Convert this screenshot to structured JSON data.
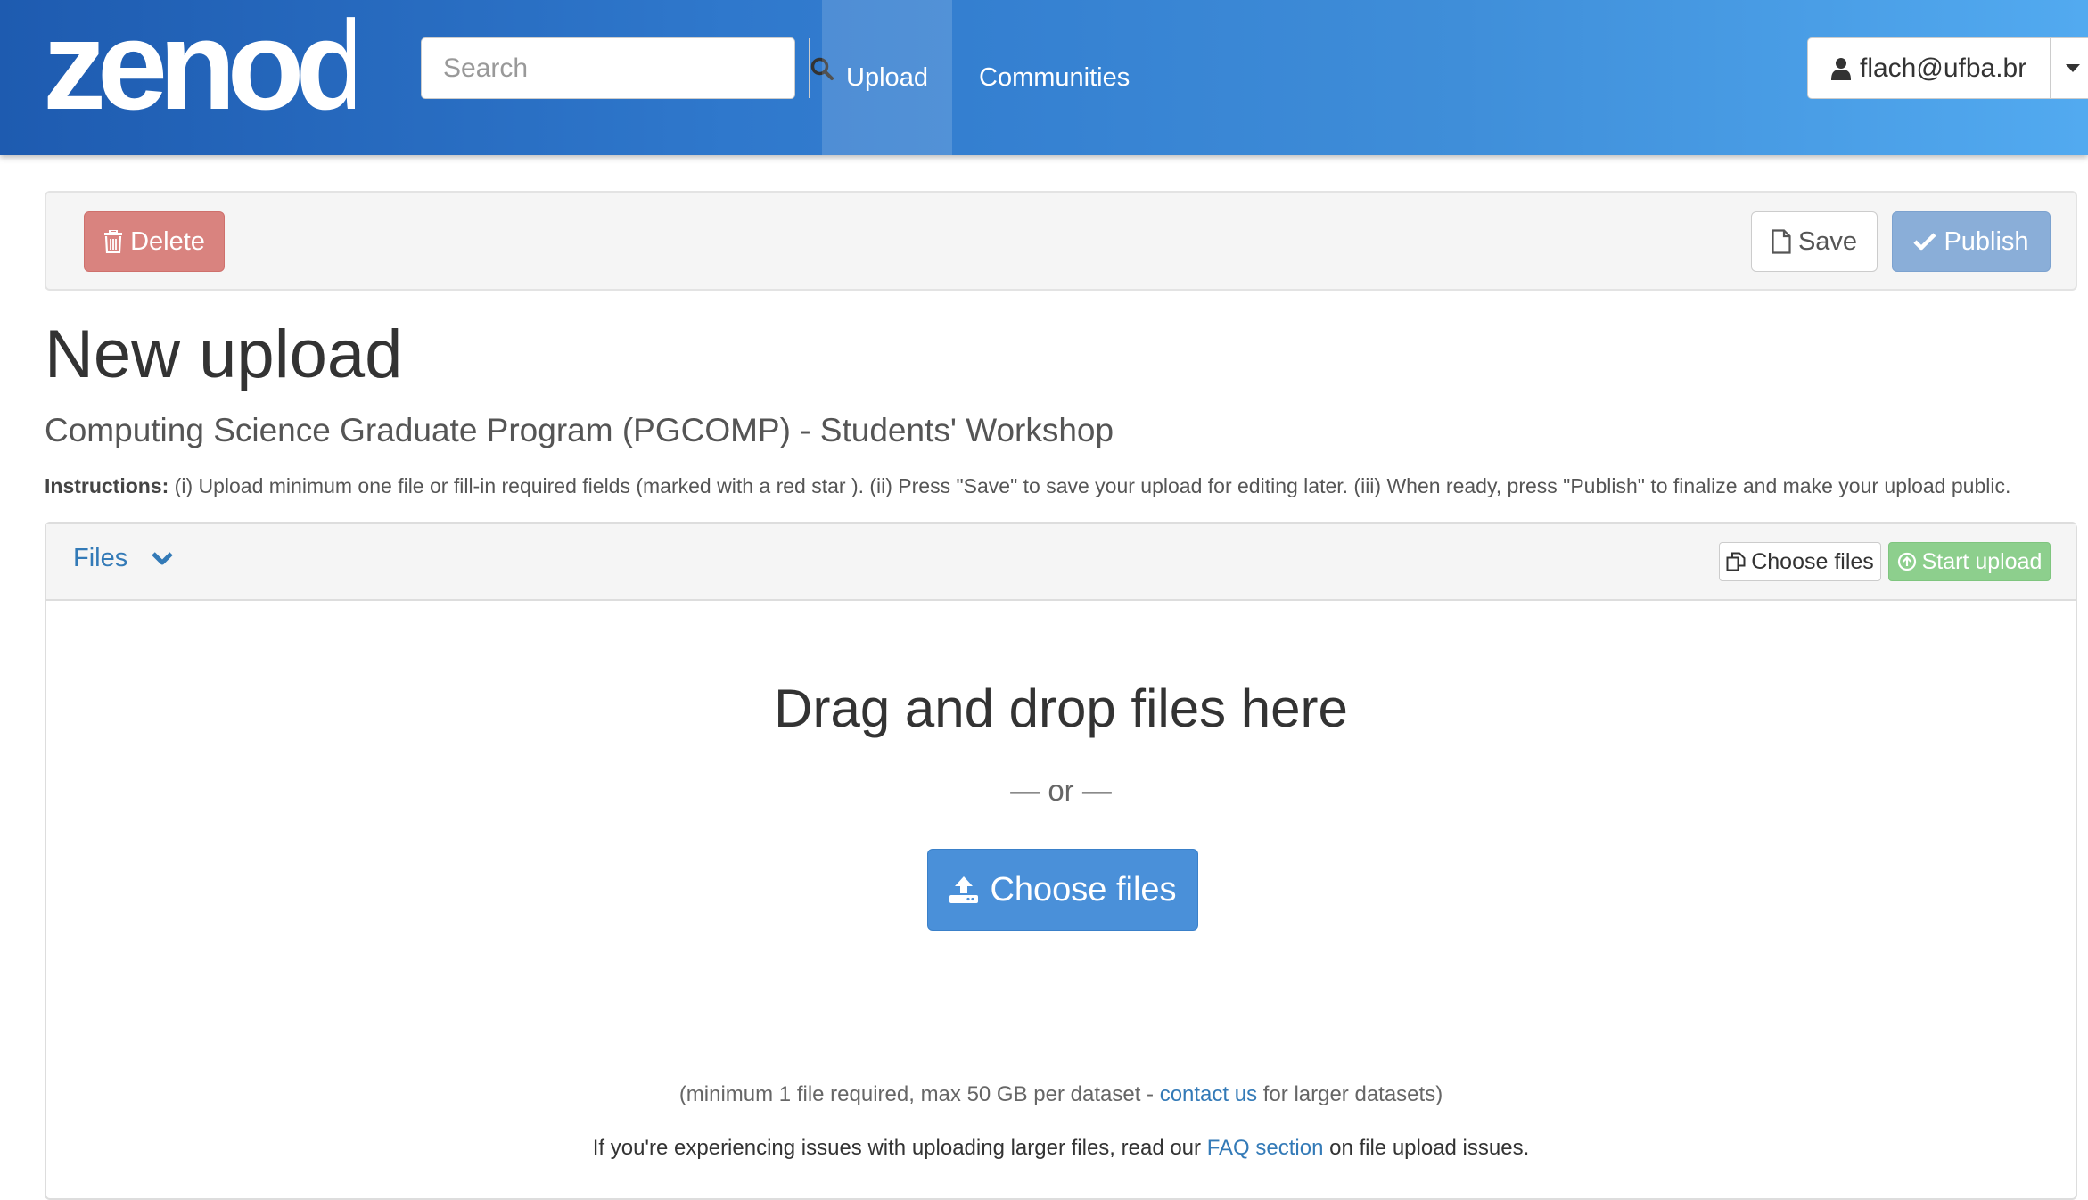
{
  "brand": {
    "logo_text": "zenodo"
  },
  "search": {
    "placeholder": "Search"
  },
  "nav": {
    "upload": "Upload",
    "communities": "Communities"
  },
  "user": {
    "email": "flach@ufba.br"
  },
  "actions": {
    "delete": "Delete",
    "save": "Save",
    "publish": "Publish"
  },
  "page": {
    "title": "New upload",
    "community": "Computing Science Graduate Program (PGCOMP) - Students' Workshop",
    "instructions_label": "Instructions:",
    "instructions_text": " (i) Upload minimum one file or fill-in required fields (marked with a red star ). (ii) Press \"Save\" to save your upload for editing later. (iii) When ready, press \"Publish\" to finalize and make your upload public."
  },
  "files": {
    "title": "Files",
    "choose_files_small": "Choose files",
    "start_upload": "Start upload",
    "drop_title": "Drag and drop files here",
    "or_text": "— or —",
    "choose_files_big": "Choose files",
    "note1_before": "(minimum 1 file required, max 50 GB per dataset - ",
    "note1_link": "contact us",
    "note1_after": " for larger datasets)",
    "note2_before": "If you're experiencing issues with uploading larger files, read our ",
    "note2_link": "FAQ section",
    "note2_after": " on file upload issues."
  },
  "colors": {
    "navbar_start": "#1e5bb0",
    "navbar_end": "#52aaf0",
    "delete": "#d9837f",
    "publish": "#8aaed8",
    "start_upload": "#8dcf8d",
    "primary": "#4a90d9",
    "link": "#337ab7"
  },
  "icons": [
    "search-icon",
    "user-icon",
    "caret-down-icon",
    "trash-icon",
    "file-icon",
    "check-icon",
    "chevron-down-icon",
    "copy-icon",
    "upload-circle-icon",
    "upload-icon"
  ]
}
